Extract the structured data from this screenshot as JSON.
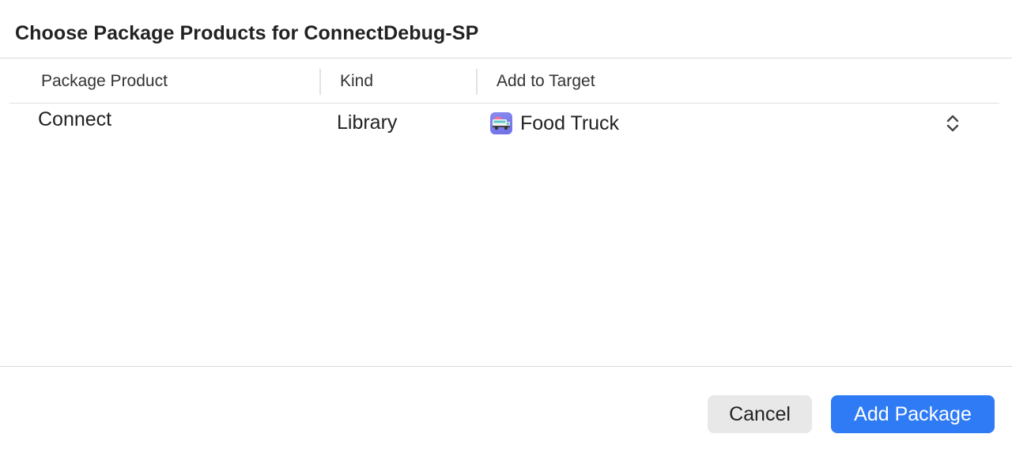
{
  "dialog": {
    "title": "Choose Package Products for ConnectDebug-SP"
  },
  "table": {
    "columns": [
      "Package Product",
      "Kind",
      "Add to Target"
    ],
    "rows": [
      {
        "product": "Connect",
        "kind": "Library",
        "target": "Food Truck",
        "target_icon": "food-truck-app-icon"
      }
    ]
  },
  "buttons": {
    "cancel": "Cancel",
    "add": "Add Package"
  },
  "colors": {
    "accent": "#2f7bf5",
    "cancel_bg": "#e8e8e8",
    "app_icon": "#7b7ced"
  }
}
